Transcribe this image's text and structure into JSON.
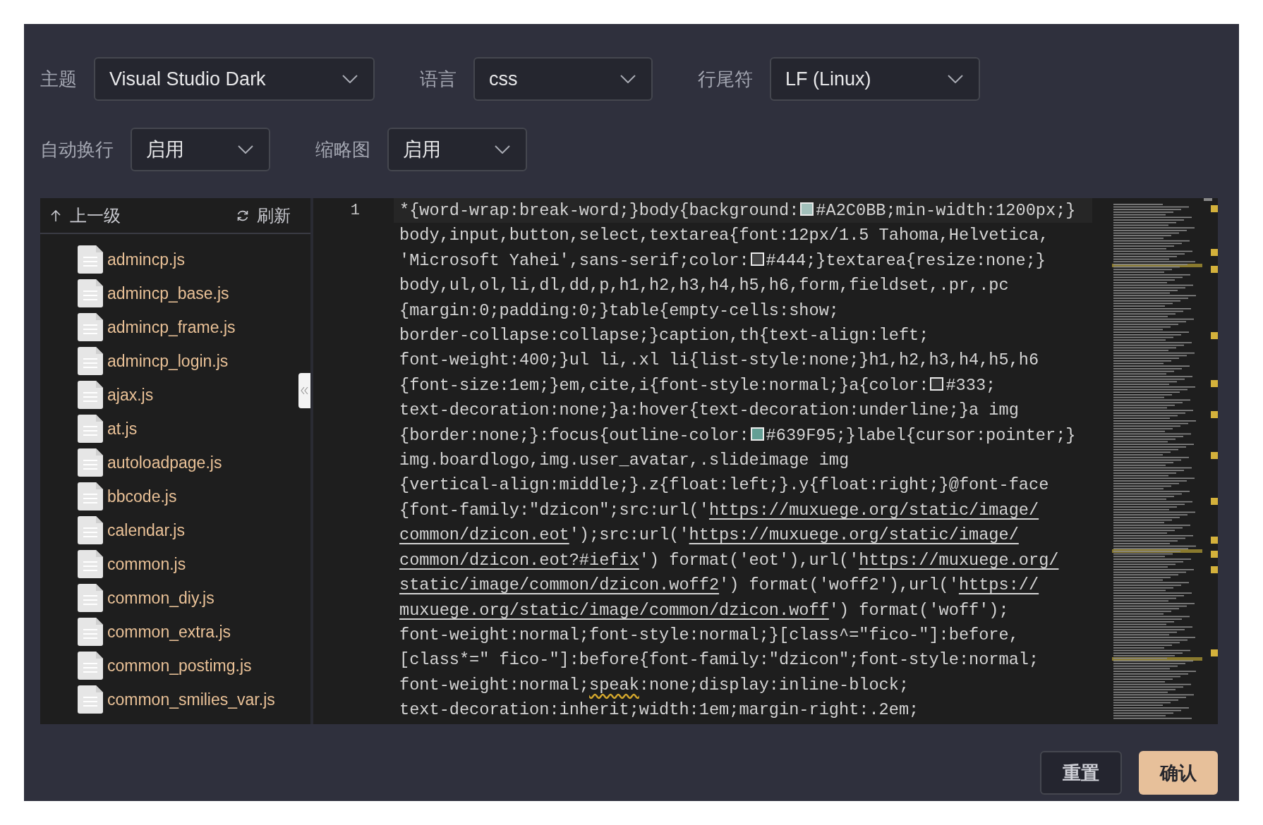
{
  "settings_rows": [
    [
      {
        "label": "主题",
        "value": "Visual Studio Dark"
      },
      {
        "label": "语言",
        "value": "css"
      },
      {
        "label": "行尾符",
        "value": "LF (Linux)"
      }
    ],
    [
      {
        "label": "自动换行",
        "value": "启用"
      },
      {
        "label": "缩略图",
        "value": "启用"
      }
    ]
  ],
  "file_browser": {
    "up_label": "上一级",
    "refresh_label": "刷新",
    "files": [
      "admincp.js",
      "admincp_base.js",
      "admincp_frame.js",
      "admincp_login.js",
      "ajax.js",
      "at.js",
      "autoloadpage.js",
      "bbcode.js",
      "calendar.js",
      "common.js",
      "common_diy.js",
      "common_extra.js",
      "common_postimg.js",
      "common_smilies_var.js"
    ]
  },
  "editor": {
    "line_numbers": [
      "1"
    ],
    "lines": [
      [
        {
          "kind": "text",
          "text": "*{word-wrap:break-word;}body{background:"
        },
        {
          "kind": "swatch",
          "color": "#a2c0bb"
        },
        {
          "kind": "text",
          "text": "#A2C0BB;min-width:1200px;}"
        }
      ],
      [
        {
          "kind": "text",
          "text": "body,input,button,select,textarea{font:12px/1.5 Tahoma,Helvetica,"
        }
      ],
      [
        {
          "kind": "text",
          "text": "'Microsoft Yahei',sans-serif;color:"
        },
        {
          "kind": "swatch",
          "color": "#444444"
        },
        {
          "kind": "text",
          "text": "#444;}textarea{resize:none;}"
        }
      ],
      [
        {
          "kind": "text",
          "text": "body,ul,ol,li,dl,dd,p,h1,h2,h3,h4,h5,h6,form,fieldset,.pr,.pc"
        }
      ],
      [
        {
          "kind": "text",
          "text": "{margin:0;padding:0;}table{empty-cells:show;"
        }
      ],
      [
        {
          "kind": "text",
          "text": "border-collapse:collapse;}caption,th{text-align:left;"
        }
      ],
      [
        {
          "kind": "text",
          "text": "font-weight:400;}ul li,.xl li{list-style:none;}h1,h2,h3,h4,h5,h6"
        }
      ],
      [
        {
          "kind": "text",
          "text": "{font-size:1em;}em,cite,i{font-style:normal;}a{color:"
        },
        {
          "kind": "swatch",
          "color": "#333333"
        },
        {
          "kind": "text",
          "text": "#333;"
        }
      ],
      [
        {
          "kind": "text",
          "text": "text-decoration:none;}a:hover{text-decoration:underline;}a img"
        }
      ],
      [
        {
          "kind": "text",
          "text": "{border:none;}:focus{outline-color:"
        },
        {
          "kind": "swatch",
          "color": "#639f95"
        },
        {
          "kind": "text",
          "text": "#639F95;}label{cursor:pointer;}"
        }
      ],
      [
        {
          "kind": "text",
          "text": "img.boardlogo,img.user_avatar,.slideimage img"
        }
      ],
      [
        {
          "kind": "text",
          "text": "{vertical-align:middle;}.z{float:left;}.y{float:right;}@font-face"
        }
      ],
      [
        {
          "kind": "text",
          "text": "{font-family:\"dzicon\";src:url('"
        },
        {
          "kind": "link",
          "text": "https://muxuege.org/static/image/"
        }
      ],
      [
        {
          "kind": "link",
          "text": "common/dzicon.eot"
        },
        {
          "kind": "text",
          "text": "');src:url('"
        },
        {
          "kind": "link",
          "text": "https://muxuege.org/static/image/"
        }
      ],
      [
        {
          "kind": "link",
          "text": "common/dzicon.eot?#iefix"
        },
        {
          "kind": "text",
          "text": "') format('eot'),url('"
        },
        {
          "kind": "link",
          "text": "https://muxuege.org/"
        }
      ],
      [
        {
          "kind": "link",
          "text": "static/image/common/dzicon.woff2"
        },
        {
          "kind": "text",
          "text": "') format('woff2'),url('"
        },
        {
          "kind": "link",
          "text": "https://"
        }
      ],
      [
        {
          "kind": "link",
          "text": "muxuege.org/static/image/common/dzicon.woff"
        },
        {
          "kind": "text",
          "text": "') format('woff');"
        }
      ],
      [
        {
          "kind": "text",
          "text": "font-weight:normal;font-style:normal;}[class^=\"fico-\"]:before,"
        }
      ],
      [
        {
          "kind": "text",
          "text": "[class*=\" fico-\"]:before{font-family:\"dzicon\";font-style:normal;"
        }
      ],
      [
        {
          "kind": "text",
          "text": "font-weight:normal;"
        },
        {
          "kind": "warning",
          "text": "speak"
        },
        {
          "kind": "text",
          "text": ":none;display:inline-block;"
        }
      ],
      [
        {
          "kind": "text",
          "text": "text-decoration:inherit;width:1em;margin-right:.2em;"
        }
      ]
    ]
  },
  "buttons": [
    {
      "label": "重置",
      "kind": "secondary"
    },
    {
      "label": "确认",
      "kind": "primary"
    }
  ]
}
